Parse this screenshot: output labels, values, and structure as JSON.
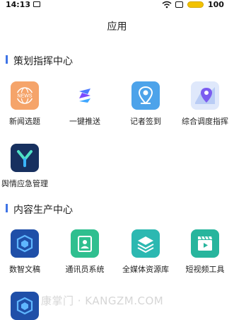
{
  "status_bar": {
    "time": "14:13",
    "battery": "100"
  },
  "header": {
    "title": "应用"
  },
  "sections": [
    {
      "label": "策划指挥中心"
    },
    {
      "label": "内容生产中心"
    }
  ],
  "apps": {
    "news": "新闻选题",
    "push": "一键推送",
    "checkin": "记者签到",
    "dispatch": "综合调度指挥",
    "opinion": "舆情应急管理",
    "digital": "数智文稿",
    "correspondent": "通讯员系统",
    "media": "全媒体资源库",
    "video": "短视频工具"
  },
  "icon_badges": {
    "news": "NEWS"
  },
  "watermark": "康掌门 · KANGZM.COM",
  "colors": {
    "accent": "#3f74e6",
    "news_icon": "#f5a46a",
    "checkin_icon": "#4da3ea",
    "digital_icon": "#1f4fa8",
    "correspondent_icon": "#2fbf8f",
    "media_icon": "#2cb8b1",
    "video_icon": "#27b59d"
  }
}
